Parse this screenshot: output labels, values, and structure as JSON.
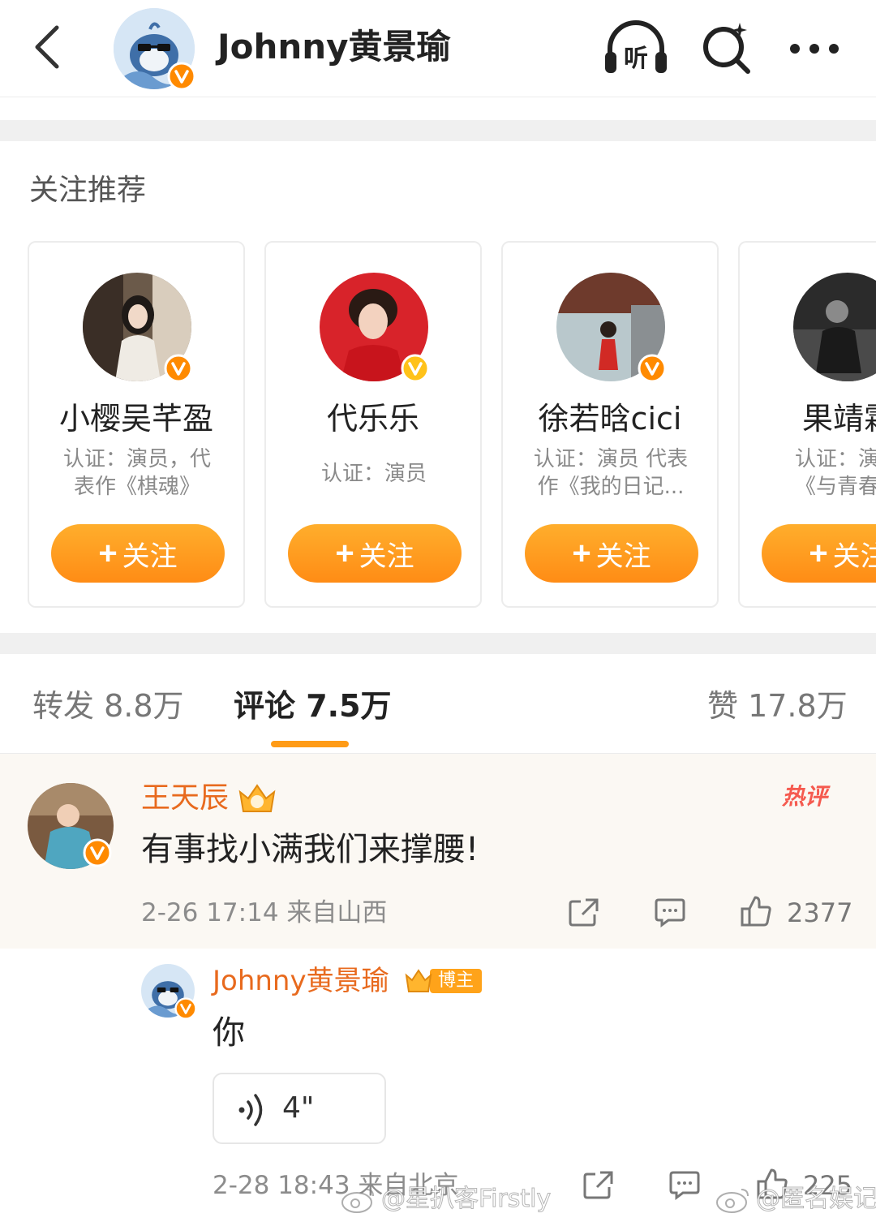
{
  "header": {
    "title": "Johnny黄景瑜",
    "listen_label": "听"
  },
  "recommend": {
    "title": "关注推荐",
    "cards": [
      {
        "name": "小樱吴芊盈",
        "desc": "认证：演员，代\n表作《棋魂》",
        "follow": "关注"
      },
      {
        "name": "代乐乐",
        "desc": "认证：演员",
        "follow": "关注"
      },
      {
        "name": "徐若晗cici",
        "desc": "认证：演员 代表\n作《我的日记...",
        "follow": "关注"
      },
      {
        "name": "果靖霖",
        "desc": "认证：演员\n《与青春有",
        "follow": "关注"
      }
    ]
  },
  "tabs": {
    "repost": "转发 8.8万",
    "comments": "评论 7.5万",
    "likes": "赞 17.8万"
  },
  "comment": {
    "author": "王天辰",
    "hot_badge": "热评",
    "text": "有事找小满我们来撑腰!",
    "meta": "2-26 17:14  来自山西",
    "like_count": "2377",
    "reply": {
      "author": "Johnny黄景瑜",
      "badge": "博主",
      "text": "你",
      "voice_duration": "4\"",
      "meta": "2-28 18:43  来自北京",
      "like_count": "225"
    }
  },
  "watermarks": [
    "@星扒客Firstly",
    "@匿名娱记"
  ],
  "colors": {
    "accent_orange": "#ff9b16",
    "name_orange": "#e86a1e",
    "hot_red": "#f55a4f",
    "verified_badge": "#ff8a00"
  }
}
